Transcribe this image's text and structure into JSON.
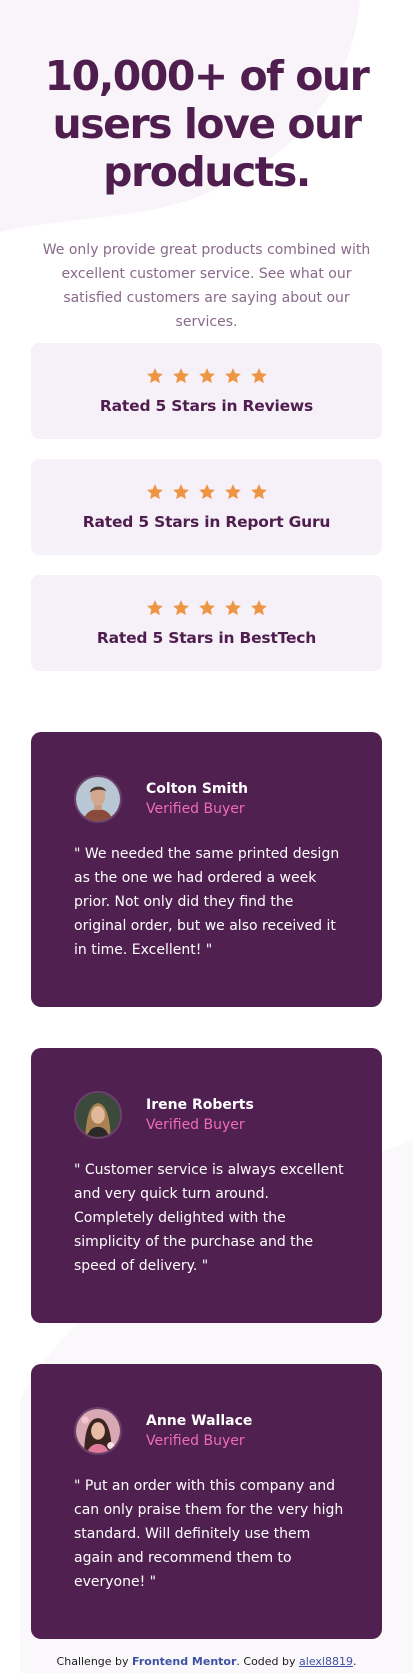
{
  "hero": {
    "headline": "10,000+ of our users love our products.",
    "intro": "We only provide great products combined with excellent customer service. See what our satisfied customers are saying about our services."
  },
  "ratings": [
    {
      "label": "Rated 5 Stars in Reviews",
      "stars": 5
    },
    {
      "label": "Rated 5 Stars in Report Guru",
      "stars": 5
    },
    {
      "label": "Rated 5 Stars in BestTech",
      "stars": 5
    }
  ],
  "testimonials": [
    {
      "name": "Colton Smith",
      "role": "Verified Buyer",
      "quote": "\" We needed the same printed design as the one we had ordered a week prior. Not only did they find the original order, but we also received it in time. Excellent! \""
    },
    {
      "name": "Irene Roberts",
      "role": "Verified Buyer",
      "quote": "\" Customer service is always excellent and very quick turn around. Completely delighted with the simplicity of the purchase and the speed of delivery. \""
    },
    {
      "name": "Anne Wallace",
      "role": "Verified Buyer",
      "quote": "\" Put an order with this company and can only praise them for the very high standard. Will definitely use them again and recommend them to everyone! \""
    }
  ],
  "attribution": {
    "prefix": "Challenge by ",
    "challenge_link": "Frontend Mentor",
    "middle": ". Coded by ",
    "author_link": "alexl8819",
    "suffix": "."
  },
  "colors": {
    "primary": "#4f1e4f",
    "card_bg": "#502050",
    "rating_bg": "#f6f0f8",
    "star": "#ee9544",
    "accent_pink": "#ee6bbd"
  },
  "icons": {
    "star": "star-icon"
  }
}
